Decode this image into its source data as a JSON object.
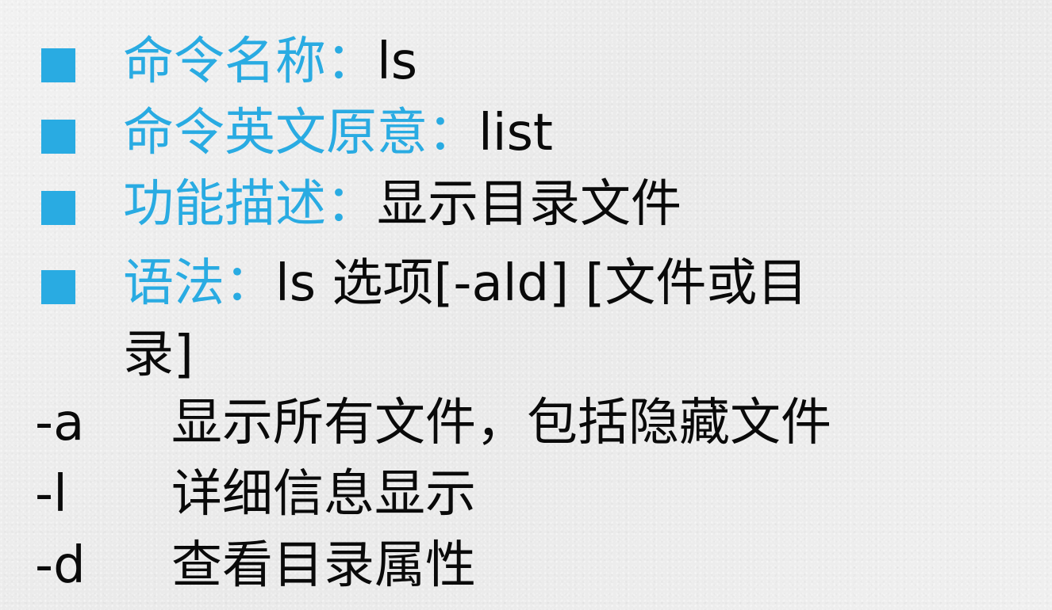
{
  "slide": {
    "colors": {
      "accent": "#29abe2",
      "text": "#0a0a0a",
      "background": "#eeeeee"
    },
    "bullets": [
      {
        "label": "命令名称：",
        "value": "ls"
      },
      {
        "label": "命令英文原意：",
        "value": "list"
      },
      {
        "label": "功能描述：",
        "value": "显示目录文件"
      },
      {
        "label": "语法：",
        "value": "ls 选项[-ald]  [文件或目"
      }
    ],
    "syntax_continuation": "录]",
    "options": [
      {
        "flag": "-a",
        "desc": "显示所有文件，包括隐藏文件"
      },
      {
        "flag": "-l",
        "desc": "详细信息显示"
      },
      {
        "flag": "-d",
        "desc": "查看目录属性"
      }
    ]
  }
}
